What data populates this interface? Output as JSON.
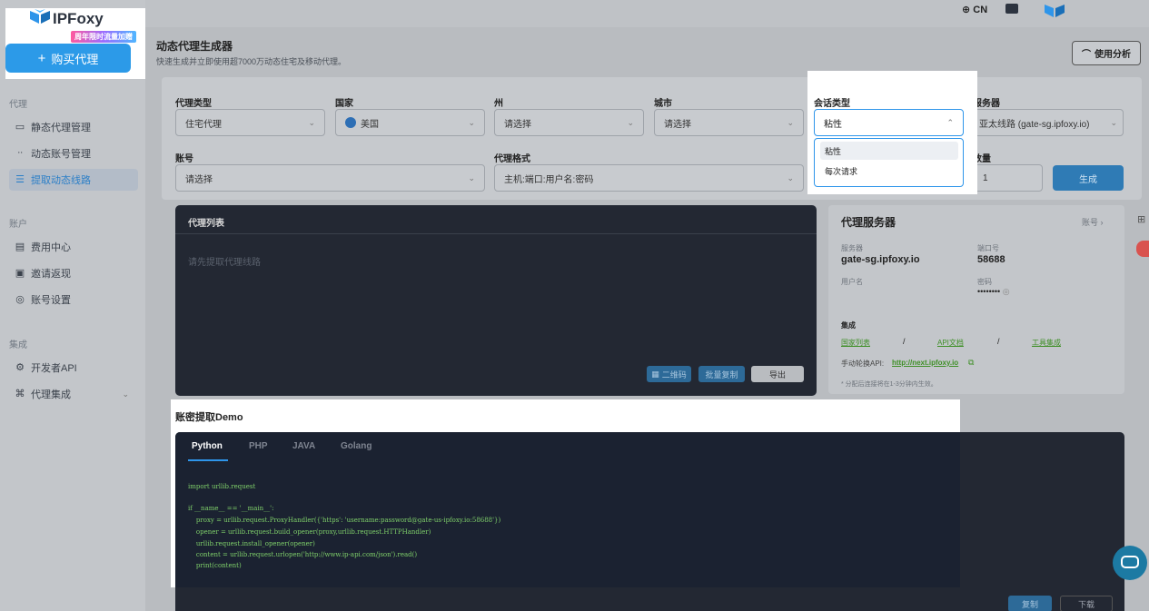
{
  "sidebar": {
    "logo_text": "IPFoxy",
    "promo": "周年限时流量加赠",
    "buy_button": "购买代理",
    "buy_icon": "plus-icon",
    "sections": [
      {
        "title": "代理",
        "items": [
          {
            "label": "静态代理管理",
            "icon": "monitor-icon"
          },
          {
            "label": "动态账号管理",
            "icon": "users-icon"
          },
          {
            "label": "提取动态线路",
            "icon": "list-icon",
            "active": true
          }
        ]
      },
      {
        "title": "账户",
        "items": [
          {
            "label": "费用中心",
            "icon": "wallet-icon"
          },
          {
            "label": "邀请返现",
            "icon": "gift-icon"
          },
          {
            "label": "账号设置",
            "icon": "settings-icon"
          }
        ]
      },
      {
        "title": "集成",
        "items": [
          {
            "label": "开发者API",
            "icon": "api-icon"
          },
          {
            "label": "代理集成",
            "icon": "plugin-icon",
            "chevron": true
          }
        ]
      }
    ]
  },
  "topbar": {
    "language": "CN"
  },
  "header": {
    "title": "动态代理生成器",
    "subtitle": "快速生成并立即使用超7000万动态住宅及移动代理。",
    "analysis_button": "使用分析"
  },
  "form": {
    "proxy_type": {
      "label": "代理类型",
      "value": "住宅代理"
    },
    "country": {
      "label": "国家",
      "value": "美国"
    },
    "state": {
      "label": "州",
      "value": "请选择"
    },
    "city": {
      "label": "城市",
      "value": "请选择"
    },
    "session": {
      "label": "会话类型",
      "value": "粘性",
      "options": [
        "粘性",
        "每次请求"
      ]
    },
    "server": {
      "label": "服务器",
      "value": "亚太线路 (gate-sg.ipfoxy.io)"
    },
    "account": {
      "label": "账号",
      "value": "请选择"
    },
    "format": {
      "label": "代理格式",
      "value": "主机:端口:用户名:密码"
    },
    "quantity": {
      "label": "数量",
      "value": "1"
    },
    "generate_button": "生成"
  },
  "proxy_list": {
    "title": "代理列表",
    "empty": "请先提取代理线路",
    "qr_button": "二维码",
    "batch_copy_button": "批量复制",
    "export_button": "导出"
  },
  "server_info": {
    "title": "代理服务器",
    "account_link": "账号",
    "server_label": "服务器",
    "server_value": "gate-sg.ipfoxy.io",
    "port_label": "端口号",
    "port_value": "58688",
    "user_label": "用户名",
    "password_label": "密码",
    "password_value": "••••••••",
    "integration_title": "集成",
    "links": [
      "国家列表",
      "API文档",
      "工具集成"
    ],
    "sep": "/",
    "api_label": "手动轮换API:",
    "api_link": "http://next.ipfoxy.io",
    "note": "* 分配后连接将在1-3分钟内生效。"
  },
  "demo": {
    "title": "账密提取Demo",
    "tabs": [
      "Python",
      "PHP",
      "JAVA",
      "Golang"
    ],
    "code_lines": [
      "import urllib.request",
      "",
      "if __name__ == '__main__':",
      "    proxy = urllib.request.ProxyHandler({'https': 'username:password@gate-us-ipfoxy.io:58688'})",
      "    opener = urllib.request.build_opener(proxy,urllib.request.HTTPHandler)",
      "    urllib.request.install_opener(opener)",
      "    content = urllib.request.urlopen('http://www.ip-api.com/json').read()",
      "    print(content)"
    ],
    "copy_button": "复制",
    "download_button": "下载"
  }
}
